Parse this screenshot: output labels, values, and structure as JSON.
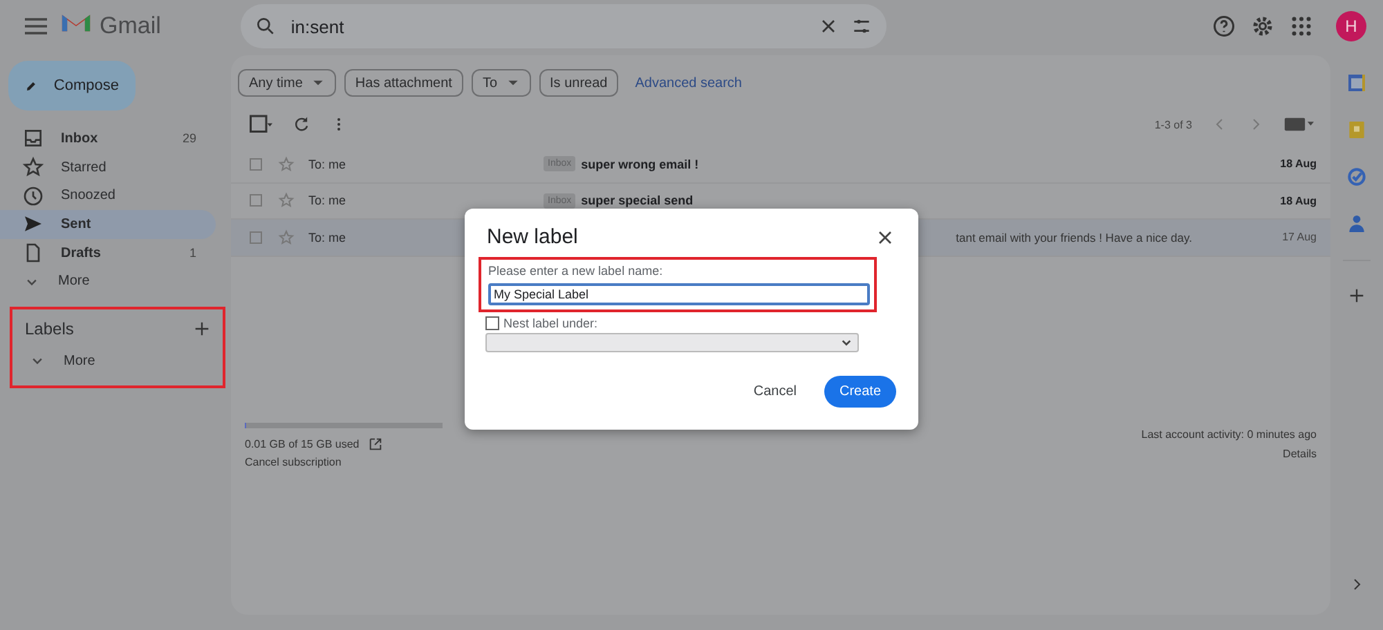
{
  "app": {
    "name": "Gmail"
  },
  "search": {
    "value": "in:sent"
  },
  "avatar": {
    "letter": "H"
  },
  "compose": {
    "label": "Compose"
  },
  "nav": [
    {
      "kind": "inbox",
      "label": "Inbox",
      "count": "29",
      "unread": true,
      "selected": false
    },
    {
      "kind": "star",
      "label": "Starred",
      "unread": false,
      "selected": false
    },
    {
      "kind": "clock",
      "label": "Snoozed",
      "unread": false,
      "selected": false
    },
    {
      "kind": "send",
      "label": "Sent",
      "unread": false,
      "selected": true
    },
    {
      "kind": "file",
      "label": "Drafts",
      "count": "1",
      "unread": true,
      "selected": false
    },
    {
      "kind": "chevron",
      "label": "More",
      "unread": false,
      "selected": false
    }
  ],
  "labels_section": {
    "title": "Labels",
    "more": "More",
    "highlighted": true
  },
  "filters": [
    {
      "label": "Any time",
      "dropdown": true
    },
    {
      "label": "Has attachment",
      "dropdown": false
    },
    {
      "label": "To",
      "dropdown": true
    },
    {
      "label": "Is unread",
      "dropdown": false
    }
  ],
  "advanced_search": "Advanced search",
  "pagination": "1-3 of 3",
  "emails": [
    {
      "sender": "To: me",
      "tag": "Inbox",
      "subject": "super wrong email !",
      "date": "18 Aug",
      "unread": true
    },
    {
      "sender": "To: me",
      "tag": "Inbox",
      "subject": "super special send",
      "date": "18 Aug",
      "unread": true
    },
    {
      "sender": "To: me",
      "snippet": "tant email with your friends ! Have a nice day.",
      "date": "17 Aug",
      "unread": false
    }
  ],
  "storage": {
    "text": "0.01 GB of 15 GB used",
    "level": 0.01,
    "cancel": "Cancel subscription"
  },
  "activity": {
    "text": "Last account activity: 0 minutes ago",
    "details": "Details"
  },
  "dialog": {
    "title": "New label",
    "prompt": "Please enter a new label name:",
    "value": "My Special Label",
    "highlighted": true,
    "nest": {
      "label": "Nest label under:",
      "checked": false
    },
    "select_disabled": true,
    "cancel": "Cancel",
    "create": "Create"
  }
}
